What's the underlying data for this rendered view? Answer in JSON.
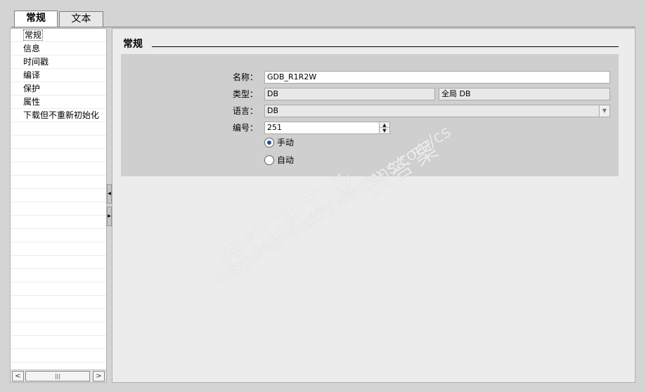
{
  "tabs": [
    {
      "label": "常规",
      "active": true
    },
    {
      "label": "文本",
      "active": false
    }
  ],
  "nav": {
    "items": [
      "常规",
      "信息",
      "时间戳",
      "编译",
      "保护",
      "属性",
      "下载但不重新初始化"
    ],
    "selected_index": 0
  },
  "section": {
    "title": "常规"
  },
  "form": {
    "name_label": "名称：",
    "name_value": "GDB_R1R2W",
    "type_label": "类型：",
    "type_value": "DB",
    "type_scope": "全局 DB",
    "lang_label": "语言：",
    "lang_value": "DB",
    "number_label": "编号：",
    "number_value": "251",
    "radio_manual": "手动",
    "radio_auto": "自动",
    "manual_checked": true
  },
  "watermark": {
    "cn": "西门子工业",
    "cn2": "找答案",
    "url": "support.industry.siemens.com/cs"
  },
  "scrollbar": {
    "left_arrow": "<",
    "right_arrow": ">",
    "thumb_grip": "|||"
  },
  "colors": {
    "background": "#d4d4d4",
    "panel": "#ececec",
    "group_box": "#cfcfcf",
    "radio_dot": "#2b4d8e"
  }
}
